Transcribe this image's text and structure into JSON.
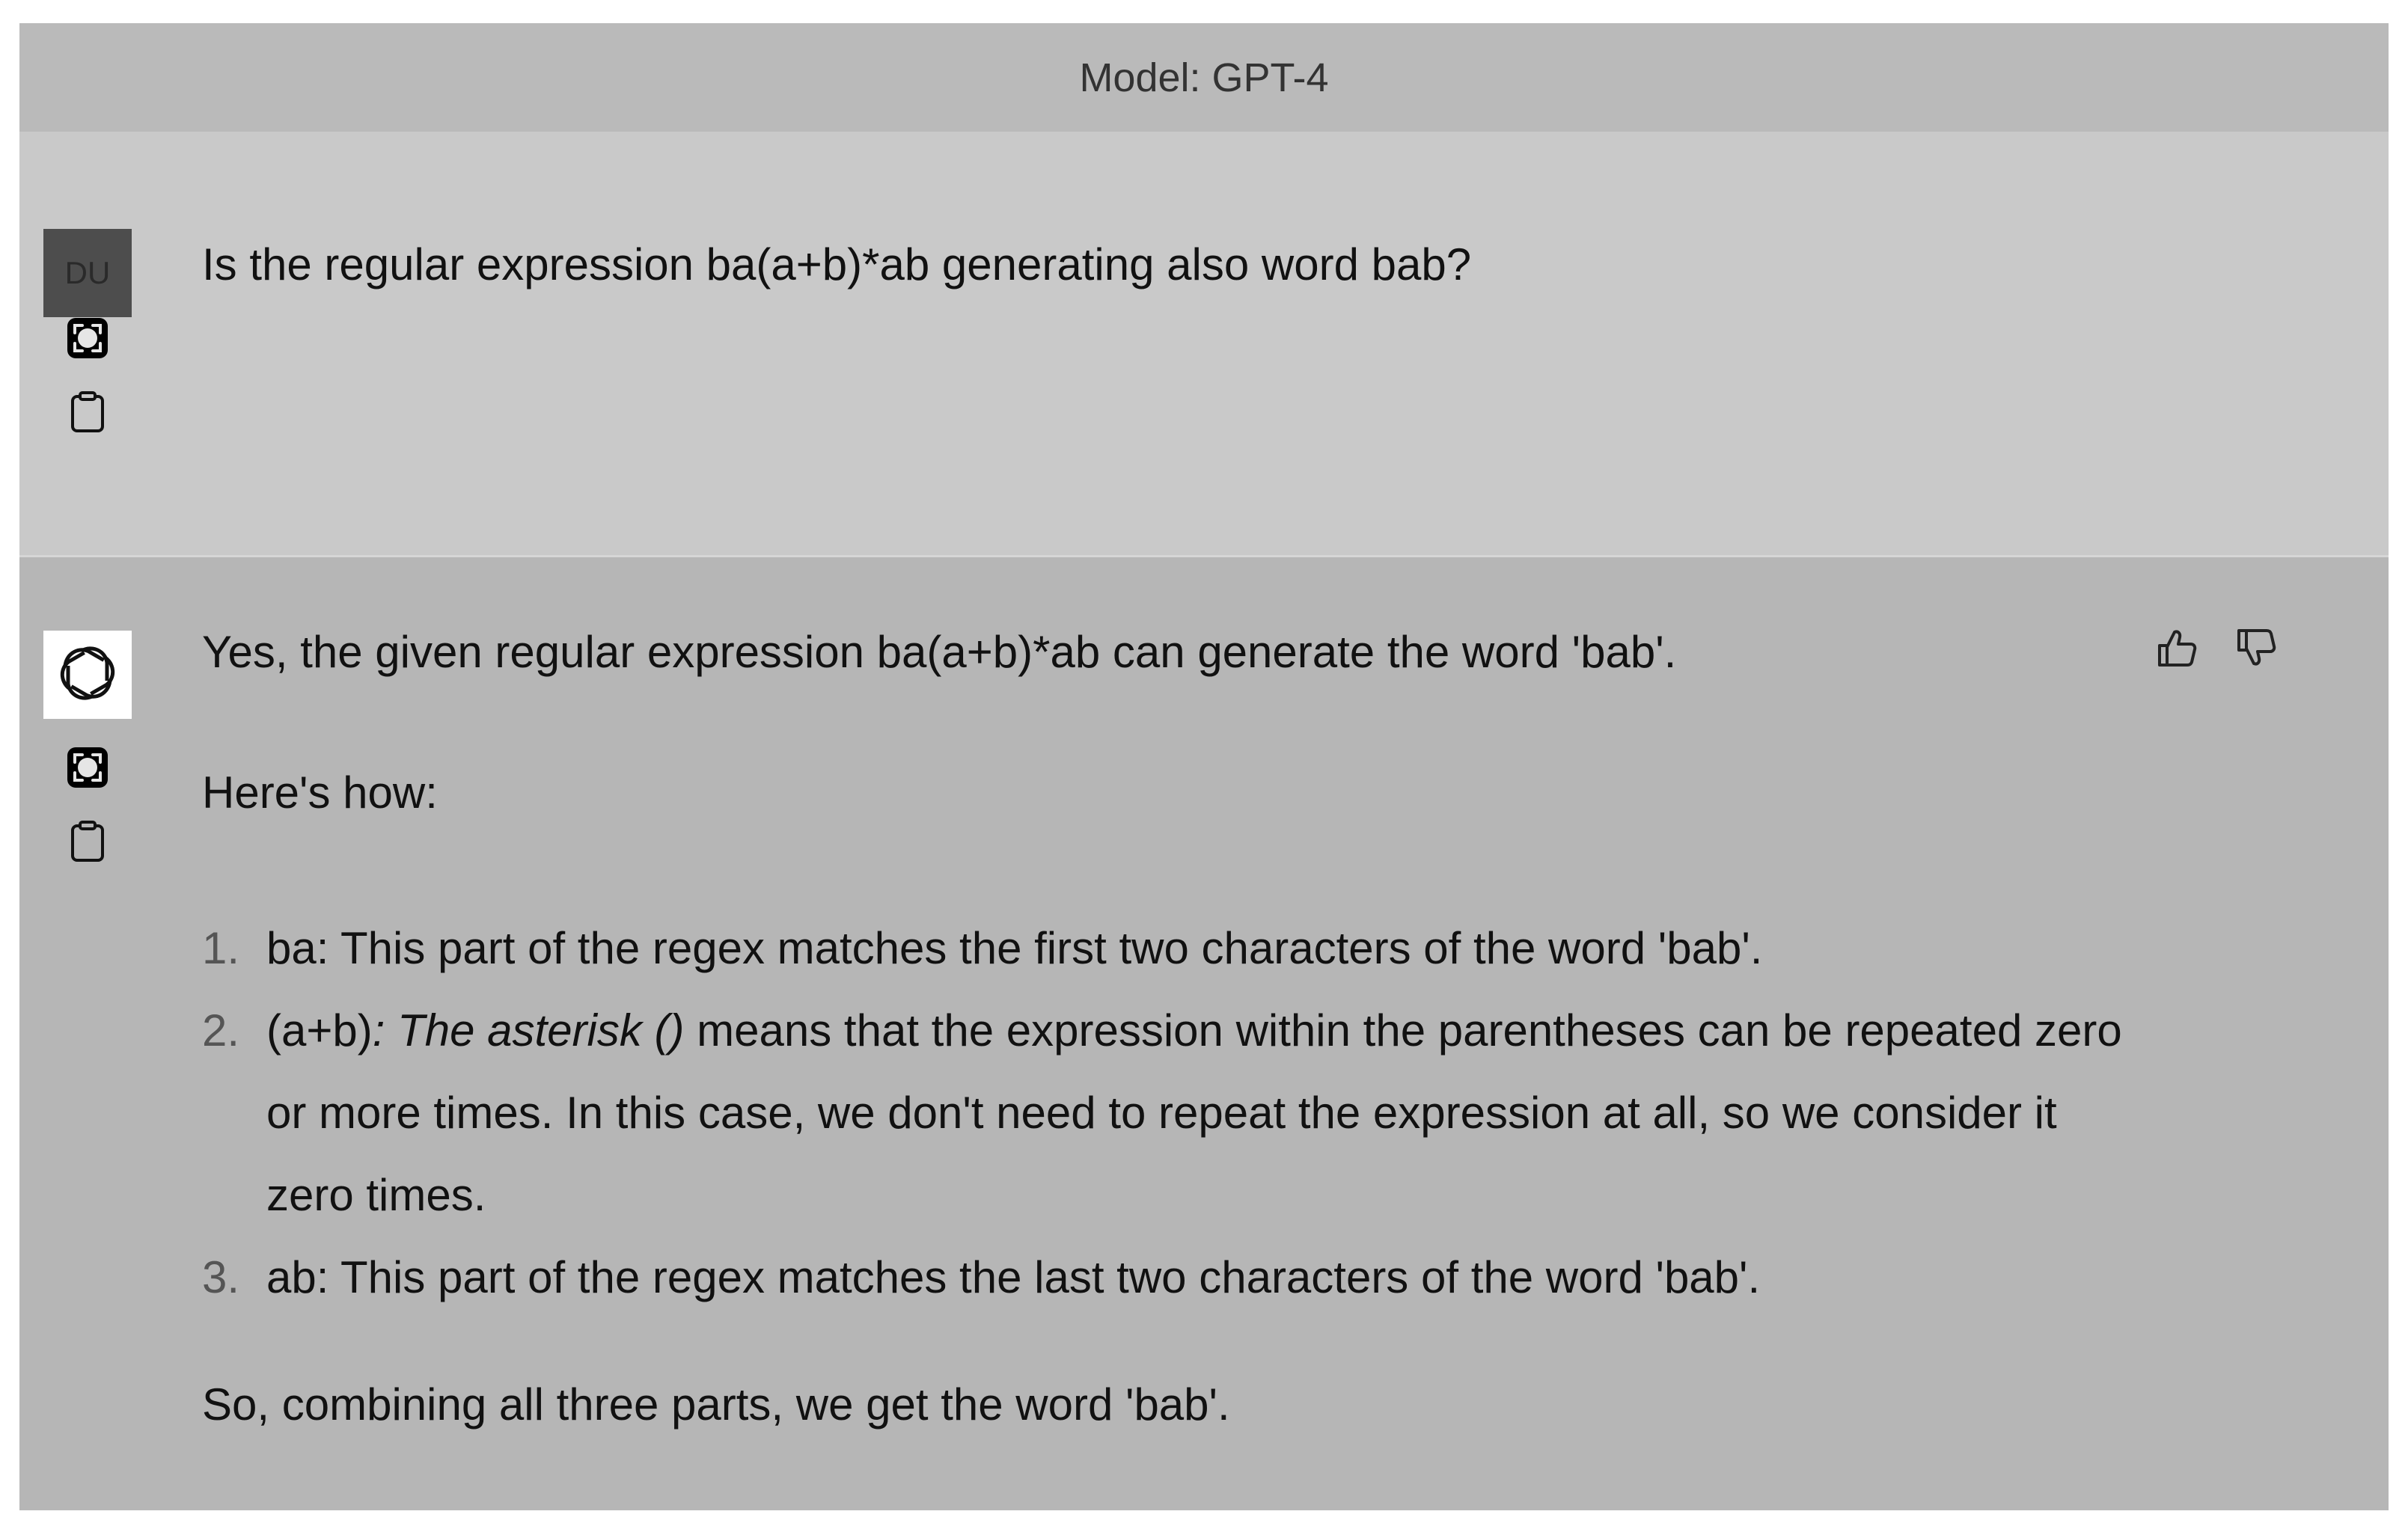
{
  "header": {
    "model_label": "Model: GPT-4"
  },
  "user_message": {
    "avatar_initials": "DU",
    "text": "Is the regular expression ba(a+b)*ab generating also word bab?"
  },
  "assistant_message": {
    "avatar_icon": "openai-logo-icon",
    "intro": "Yes, the given regular expression ba(a+b)*ab can generate the word 'bab'.",
    "heres_how": "Here's how:",
    "steps": [
      {
        "number": "1.",
        "text": "ba: This part of the regex matches the first two characters of the word 'bab'."
      },
      {
        "number": "2.",
        "prefix": "(a+b)",
        "italic": ": The asterisk ()",
        "rest": " means that the expression within the parentheses can be repeated zero or more times. In this case, we don't need to repeat the expression at all, so we consider it zero times."
      },
      {
        "number": "3.",
        "text": "ab: This part of the regex matches the last two characters of the word 'bab'."
      }
    ],
    "conclusion": "So, combining all three parts, we get the word 'bab'."
  },
  "icons": {
    "capture": "screenshot-capture-icon",
    "clipboard": "clipboard-icon",
    "thumbs_up": "thumbs-up-icon",
    "thumbs_down": "thumbs-down-icon"
  }
}
